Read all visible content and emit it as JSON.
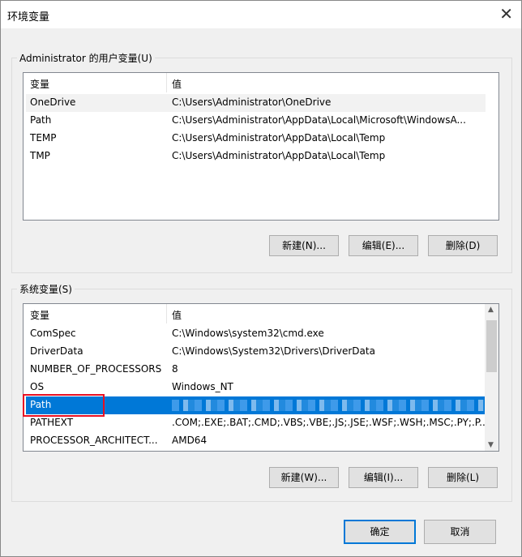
{
  "window": {
    "title": "环境变量",
    "close_icon": "close-icon"
  },
  "user_vars": {
    "group_label": "Administrator 的用户变量(U)",
    "columns": [
      "变量",
      "值"
    ],
    "rows": [
      {
        "name": "OneDrive",
        "value": "C:\\Users\\Administrator\\OneDrive"
      },
      {
        "name": "Path",
        "value": "C:\\Users\\Administrator\\AppData\\Local\\Microsoft\\WindowsA..."
      },
      {
        "name": "TEMP",
        "value": "C:\\Users\\Administrator\\AppData\\Local\\Temp"
      },
      {
        "name": "TMP",
        "value": "C:\\Users\\Administrator\\AppData\\Local\\Temp"
      }
    ],
    "buttons": {
      "new": "新建(N)...",
      "edit": "编辑(E)...",
      "delete": "删除(D)"
    }
  },
  "system_vars": {
    "group_label": "系统变量(S)",
    "columns": [
      "变量",
      "值"
    ],
    "rows": [
      {
        "name": "ComSpec",
        "value": "C:\\Windows\\system32\\cmd.exe"
      },
      {
        "name": "DriverData",
        "value": "C:\\Windows\\System32\\Drivers\\DriverData"
      },
      {
        "name": "NUMBER_OF_PROCESSORS",
        "value": "8"
      },
      {
        "name": "OS",
        "value": "Windows_NT"
      },
      {
        "name": "Path",
        "value": ""
      },
      {
        "name": "PATHEXT",
        "value": ".COM;.EXE;.BAT;.CMD;.VBS;.VBE;.JS;.JSE;.WSF;.WSH;.MSC;.PY;.P..."
      },
      {
        "name": "PROCESSOR_ARCHITECT...",
        "value": "AMD64"
      }
    ],
    "selected": "Path",
    "buttons": {
      "new": "新建(W)...",
      "edit": "编辑(I)...",
      "delete": "删除(L)"
    }
  },
  "footer": {
    "ok": "确定",
    "cancel": "取消"
  },
  "colors": {
    "selection": "#0078d7",
    "highlight_box": "#e81123"
  }
}
